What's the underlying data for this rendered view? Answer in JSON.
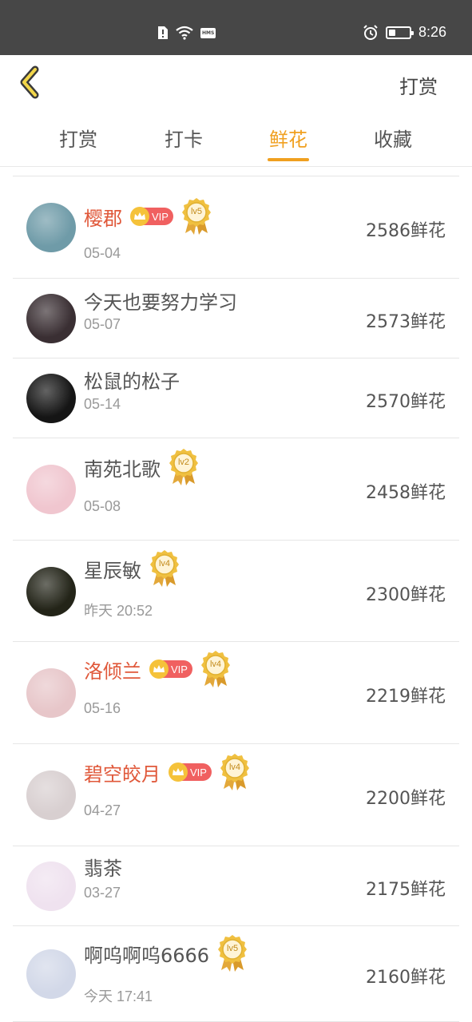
{
  "status_bar": {
    "time": "8:26",
    "hms_label": "HMS",
    "icons": [
      "sim-alert-icon",
      "wifi-icon",
      "hms-icon",
      "alarm-icon",
      "battery-icon"
    ],
    "battery_level": 0.35
  },
  "header": {
    "back_icon": "chevron-left-icon",
    "action_label": "打赏"
  },
  "tabs": [
    {
      "label": "打赏",
      "active": false
    },
    {
      "label": "打卡",
      "active": false
    },
    {
      "label": "鲜花",
      "active": true
    },
    {
      "label": "收藏",
      "active": false
    }
  ],
  "colors": {
    "accent": "#f0a020",
    "vip_name": "#e0583a",
    "status_bar": "#474747"
  },
  "vip_label": "VIP",
  "rows": [
    {
      "name": "樱郡",
      "vip": true,
      "level": "lv5",
      "date": "05-04",
      "amount": "2586鲜花",
      "avatar_color": "#6f9ba8"
    },
    {
      "name": "今天也要努力学习",
      "vip": false,
      "level": null,
      "date": "05-07",
      "amount": "2573鲜花",
      "avatar_color": "#3a2f33"
    },
    {
      "name": "松鼠的松子",
      "vip": false,
      "level": null,
      "date": "05-14",
      "amount": "2570鲜花",
      "avatar_color": "#151515"
    },
    {
      "name": "南苑北歌",
      "vip": false,
      "level": "lv2",
      "date": "05-08",
      "amount": "2458鲜花",
      "avatar_color": "#f0c6cf"
    },
    {
      "name": "星辰敏",
      "vip": false,
      "level": "lv4",
      "date": "昨天 20:52",
      "amount": "2300鲜花",
      "avatar_color": "#232418"
    },
    {
      "name": "洛倾兰",
      "vip": true,
      "level": "lv4",
      "date": "05-16",
      "amount": "2219鲜花",
      "avatar_color": "#e7c6c9"
    },
    {
      "name": "碧空皎月",
      "vip": true,
      "level": "lv4",
      "date": "04-27",
      "amount": "2200鲜花",
      "avatar_color": "#d8cfd0"
    },
    {
      "name": "翡茶",
      "vip": false,
      "level": null,
      "date": "03-27",
      "amount": "2175鲜花",
      "avatar_color": "#efe2ef"
    },
    {
      "name": "啊呜啊呜6666",
      "vip": false,
      "level": "lv5",
      "date": "今天 17:41",
      "amount": "2160鲜花",
      "avatar_color": "#d2d8e8"
    }
  ]
}
